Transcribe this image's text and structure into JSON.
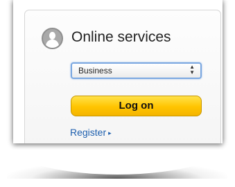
{
  "login_box": {
    "title": "Online services",
    "user_icon": "user-avatar-icon",
    "account_type": {
      "selected": "Business"
    },
    "logon_label": "Log on",
    "register_label": "Register",
    "register_arrow": "▸"
  },
  "colors": {
    "logon_button": "#ffc400",
    "link": "#1d5fae",
    "select_focus": "#7aa7e0"
  }
}
